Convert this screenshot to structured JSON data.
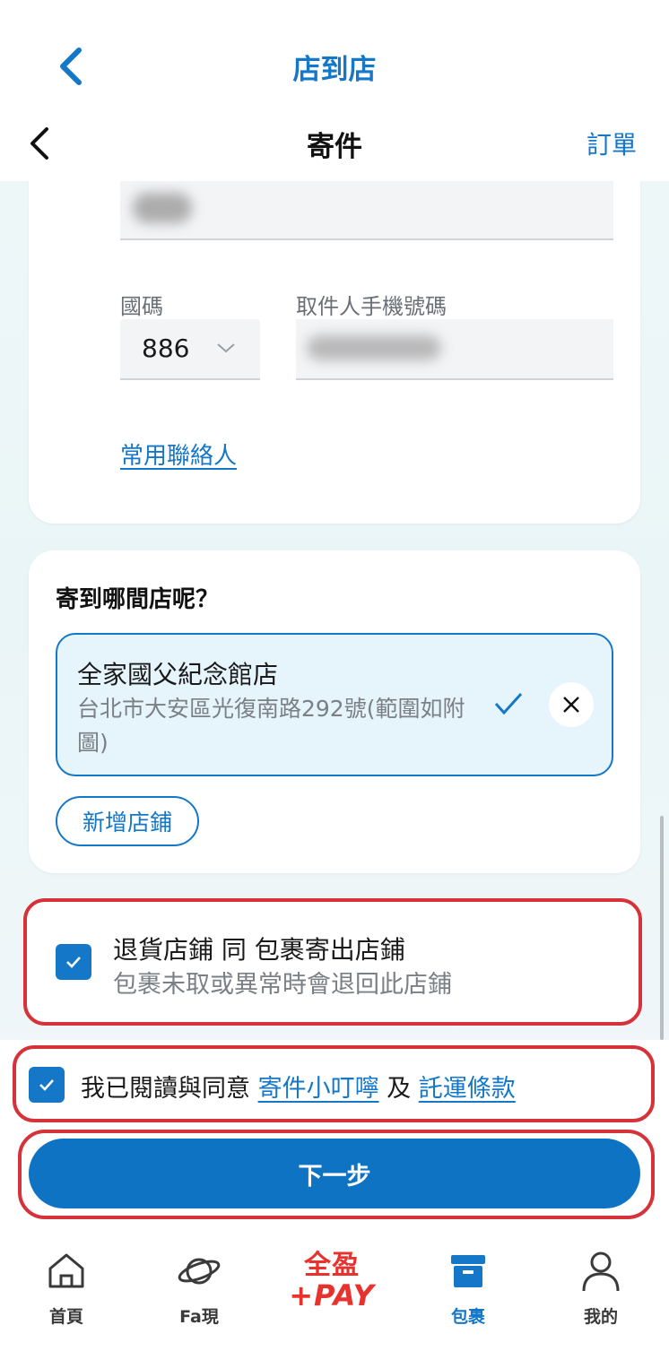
{
  "outer_header": {
    "title": "店到店"
  },
  "inner_header": {
    "title": "寄件",
    "orders_link": "訂單"
  },
  "recipient": {
    "country_code_label": "國碼",
    "country_code_value": "886",
    "phone_label": "取件人手機號碼",
    "contacts_link": "常用聯絡人"
  },
  "store": {
    "question": "寄到哪間店呢？",
    "selected_name": "全家國父紀念館店",
    "selected_address": "台北市大安區光復南路292號(範圍如附圖)",
    "add_store_label": "新增店鋪"
  },
  "return_option": {
    "title": "退貨店鋪 同 包裹寄出店鋪",
    "subtitle": "包裹未取或異常時會退回此店鋪",
    "checked": true
  },
  "agreement": {
    "prefix": "我已閱讀與同意",
    "link1": "寄件小叮嚀",
    "conj": "及",
    "link2": "託運條款",
    "checked": true
  },
  "next_button": "下一步",
  "tabs": [
    {
      "label": "首頁",
      "icon": "home-icon"
    },
    {
      "label": "Fa現",
      "icon": "planet-icon"
    },
    {
      "label": "全盈+PAY",
      "logo_top": "全盈",
      "logo_bottom": "+PAY"
    },
    {
      "label": "包裹",
      "icon": "package-icon",
      "active": true
    },
    {
      "label": "我的",
      "icon": "person-icon"
    }
  ],
  "colors": {
    "primary": "#1577c8",
    "highlight": "#d6323a",
    "pay_red": "#e8322e"
  }
}
